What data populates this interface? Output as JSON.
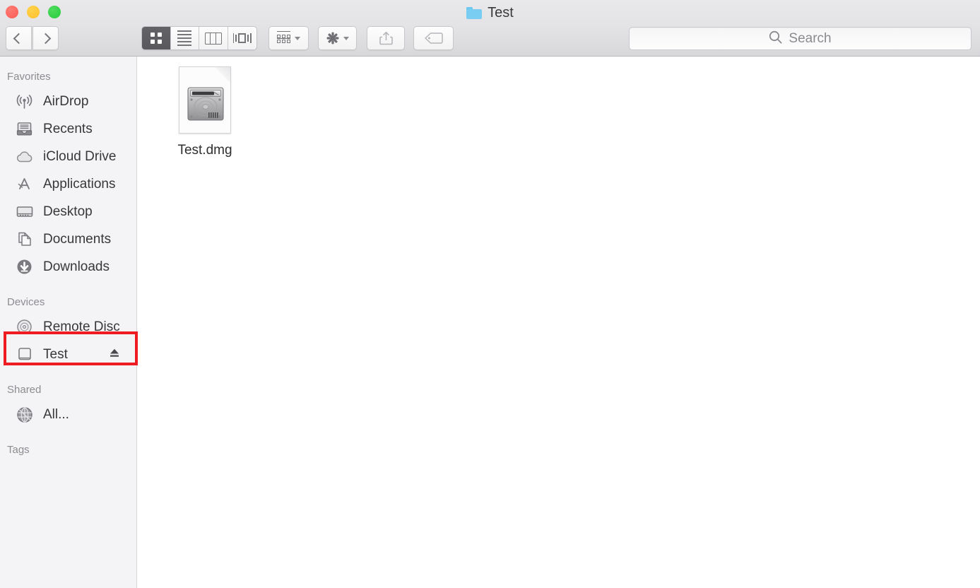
{
  "window": {
    "title": "Test",
    "title_icon": "folder-icon",
    "controls": [
      {
        "name": "close-button",
        "color": "#fc5b55"
      },
      {
        "name": "minimize-button",
        "color": "#fcc02c"
      },
      {
        "name": "maximize-button",
        "color": "#27cc3f"
      }
    ]
  },
  "toolbar": {
    "back_label": "Back",
    "forward_label": "Forward",
    "view_modes": [
      {
        "name": "icon-view",
        "label": "Icon View",
        "selected": true
      },
      {
        "name": "list-view",
        "label": "List View",
        "selected": false
      },
      {
        "name": "column-view",
        "label": "Column View",
        "selected": false
      },
      {
        "name": "coverflow-view",
        "label": "Cover Flow View",
        "selected": false
      }
    ],
    "arrange_label": "Arrange",
    "action_label": "Action",
    "share_label": "Share",
    "tags_label": "Edit Tags",
    "selected_view_bg": "#59585c"
  },
  "search": {
    "placeholder": "Search",
    "value": "",
    "icon": "search-icon"
  },
  "sidebar": {
    "sections": [
      {
        "header": "Favorites",
        "items": [
          {
            "label": "AirDrop",
            "icon": "airdrop-icon",
            "selected": false,
            "eject": false
          },
          {
            "label": "Recents",
            "icon": "recents-icon",
            "selected": false,
            "eject": false
          },
          {
            "label": "iCloud Drive",
            "icon": "icloud-icon",
            "selected": false,
            "eject": false
          },
          {
            "label": "Applications",
            "icon": "applications-icon",
            "selected": false,
            "eject": false
          },
          {
            "label": "Desktop",
            "icon": "desktop-icon",
            "selected": false,
            "eject": false
          },
          {
            "label": "Documents",
            "icon": "documents-icon",
            "selected": false,
            "eject": false
          },
          {
            "label": "Downloads",
            "icon": "downloads-icon",
            "selected": false,
            "eject": false
          }
        ]
      },
      {
        "header": "Devices",
        "items": [
          {
            "label": "Remote Disc",
            "icon": "optical-disc-icon",
            "selected": false,
            "eject": false
          },
          {
            "label": "Test",
            "icon": "hard-drive-icon",
            "selected": false,
            "eject": true
          }
        ]
      },
      {
        "header": "Shared",
        "items": [
          {
            "label": "All...",
            "icon": "network-globe-icon",
            "selected": false,
            "eject": false
          }
        ]
      },
      {
        "header": "Tags",
        "items": []
      }
    ]
  },
  "annotation": {
    "highlight_color": "#ee1b22",
    "target": "sidebar-item-test"
  },
  "content": {
    "files": [
      {
        "name": "Test.dmg",
        "icon": "disk-image-file-icon",
        "selected": false
      }
    ]
  }
}
